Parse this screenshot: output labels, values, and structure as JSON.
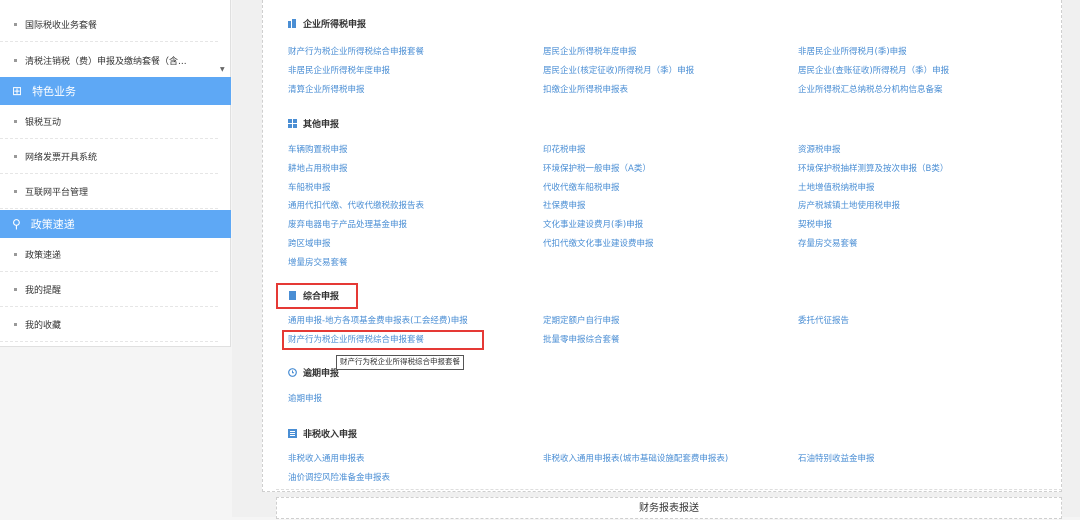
{
  "sidebar": {
    "items_top": [
      "国际税收业务套餐",
      "清税注销税（费）申报及缴纳套餐（含..."
    ],
    "special_header": "特色业务",
    "special_items": [
      "银税互动",
      "网络发票开具系统",
      "互联网平台管理"
    ],
    "policy_header": "政策速递",
    "policy_items": [
      "政策速递",
      "我的提醒",
      "我的收藏"
    ]
  },
  "sections": {
    "corp": {
      "title": "企业所得税申报",
      "links": [
        "财产行为税企业所得税综合申报套餐",
        "居民企业所得税年度申报",
        "非居民企业所得税月(季)申报",
        "非居民企业所得税年度申报",
        "居民企业(核定征收)所得税月（季）申报",
        "居民企业(查账征收)所得税月（季）申报",
        "清算企业所得税申报",
        "扣缴企业所得税申报表",
        "企业所得税汇总纳税总分机构信息备案"
      ]
    },
    "other": {
      "title": "其他申报",
      "links": [
        "车辆购置税申报",
        "印花税申报",
        "资源税申报",
        "耕地占用税申报",
        "环境保护税一般申报（A类）",
        "环境保护税抽样测算及按次申报（B类）",
        "车船税申报",
        "代收代缴车船税申报",
        "土地增值税纳税申报",
        "通用代扣代缴、代收代缴税款报告表",
        "社保费申报",
        "房产税城镇土地使用税申报",
        "废弃电器电子产品处理基金申报",
        "文化事业建设费月(季)申报",
        "契税申报",
        "跨区域申报",
        "代扣代缴文化事业建设费申报",
        "存量房交易套餐",
        "增量房交易套餐"
      ]
    },
    "combined": {
      "title": "综合申报",
      "links": [
        "通用申报-地方各项基金费申报表(工会经费)申报",
        "定期定额户自行申报",
        "委托代征报告",
        "财产行为税企业所得税综合申报套餐",
        "批量零申报综合套餐"
      ]
    },
    "overdue": {
      "title": "逾期申报",
      "links": [
        "逾期申报"
      ]
    },
    "nontax": {
      "title": "非税收入申报",
      "links": [
        "非税收入通用申报表",
        "非税收入通用申报表(城市基础设施配套费申报表)",
        "石油特别收益金申报",
        "油价调控风险准备金申报表"
      ]
    }
  },
  "tooltip": "财产行为税企业所得税综合申报套餐",
  "bottom_title": "财务报表报送",
  "colors": {
    "link": "#4a8ed4",
    "sidebar_header": "#5ea8f5",
    "highlight": "#e53935"
  }
}
